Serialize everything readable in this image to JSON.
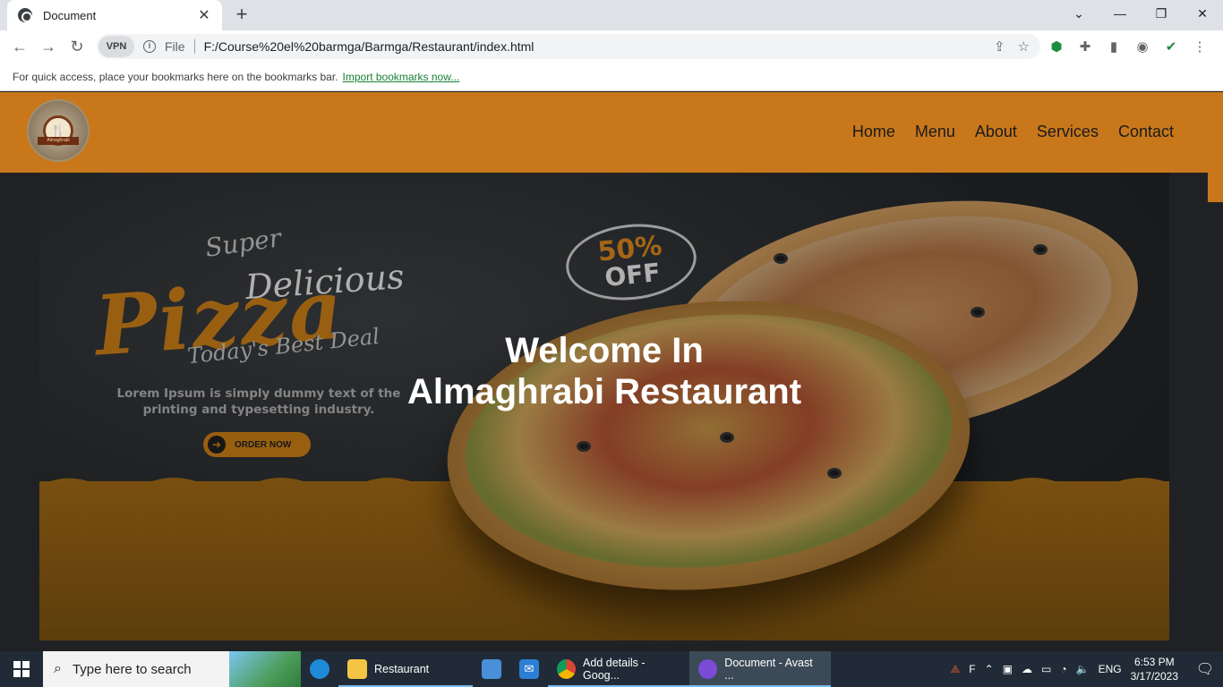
{
  "browser": {
    "tab_title": "Document",
    "tab_close": "✕",
    "new_tab": "+",
    "url_scheme_label": "File",
    "url": "F:/Course%20el%20barmga/Barmga/Restaurant/index.html",
    "vpn_label": "VPN",
    "bookmarks_hint": "For quick access, place your bookmarks here on the bookmarks bar.",
    "bookmarks_link": "Import bookmarks now..."
  },
  "site": {
    "logo_text": "Almaghrabi",
    "nav": [
      "Home",
      "Menu",
      "About",
      "Services",
      "Contact"
    ],
    "hero": {
      "title_line1": "Welcome In",
      "title_line2": "Almaghrabi Restaurant",
      "promo_super": "Super",
      "promo_delicious": "Delicious",
      "promo_pizza": "Pizza",
      "promo_deal": "Today's Best Deal",
      "promo_discount": "50%",
      "promo_off": "OFF",
      "promo_description": "Lorem Ipsum is simply dummy text of the printing and typesetting industry.",
      "promo_button": "ORDER NOW"
    }
  },
  "taskbar": {
    "search_placeholder": "Type here to search",
    "items": [
      {
        "label": "Restaurant",
        "icon": "folder-icon"
      },
      {
        "label": "Add details - Goog...",
        "icon": "chrome-icon"
      },
      {
        "label": "Document - Avast ...",
        "icon": "avast-browser-icon"
      }
    ],
    "tray_f": "F",
    "language": "ENG",
    "time": "6:53 PM",
    "date": "3/17/2023"
  }
}
